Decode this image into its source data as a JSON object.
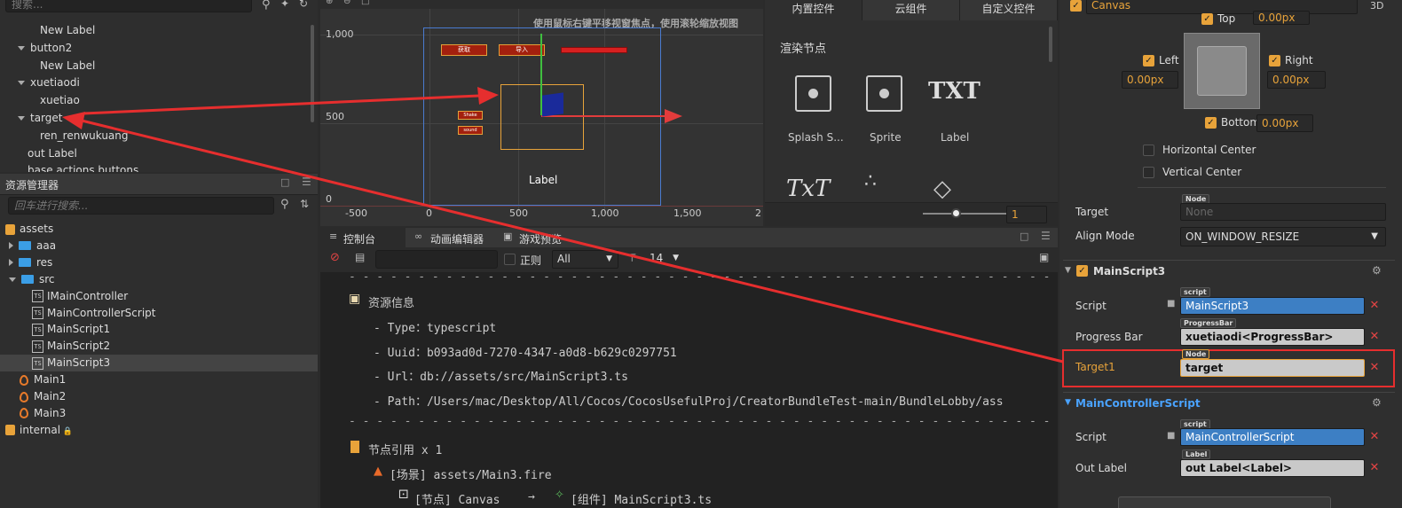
{
  "hierarchy": {
    "search_placeholder": "搜索...",
    "items": [
      {
        "label": "New Label",
        "level": 2,
        "arrow": "none"
      },
      {
        "label": "button2",
        "level": 1,
        "arrow": "down"
      },
      {
        "label": "New Label",
        "level": 2,
        "arrow": "none"
      },
      {
        "label": "xuetiaodi",
        "level": 1,
        "arrow": "down"
      },
      {
        "label": "xuetiao",
        "level": 2,
        "arrow": "none"
      },
      {
        "label": "target",
        "level": 1,
        "arrow": "down"
      },
      {
        "label": "ren_renwukuang",
        "level": 2,
        "arrow": "none"
      },
      {
        "label": "out Label",
        "level": 1,
        "arrow": "none"
      },
      {
        "label": "base actions buttons",
        "level": 1,
        "arrow": "none"
      }
    ]
  },
  "assets": {
    "title": "资源管理器",
    "search_placeholder": "回车进行搜索...",
    "items": [
      {
        "label": "assets",
        "type": "db"
      },
      {
        "label": "aaa",
        "type": "folder"
      },
      {
        "label": "res",
        "type": "folder"
      },
      {
        "label": "src",
        "type": "folder-open"
      },
      {
        "label": "IMainController",
        "type": "ts"
      },
      {
        "label": "MainControllerScript",
        "type": "ts"
      },
      {
        "label": "MainScript1",
        "type": "ts"
      },
      {
        "label": "MainScript2",
        "type": "ts"
      },
      {
        "label": "MainScript3",
        "type": "ts",
        "selected": true
      },
      {
        "label": "Main1",
        "type": "fire"
      },
      {
        "label": "Main2",
        "type": "fire"
      },
      {
        "label": "Main3",
        "type": "fire"
      },
      {
        "label": "internal",
        "type": "db-lock"
      }
    ]
  },
  "scene": {
    "hint": "使用鼠标右键平移视窗焦点，使用滚轮缩放视图",
    "y_ticks": [
      "1,000",
      "500",
      "0"
    ],
    "x_ticks": [
      "-500",
      "0",
      "500",
      "1,000",
      "1,500",
      "2"
    ],
    "label_text": "Label",
    "btn1": "获取",
    "btn2": "导入",
    "small1": "Shake",
    "small2": "sound"
  },
  "controls": {
    "tabs": [
      "内置控件",
      "云组件",
      "自定义控件"
    ],
    "section": "渲染节点",
    "items": [
      "Splash S...",
      "Sprite",
      "Label"
    ],
    "txt_icon": "TXT",
    "txt_italic": "TxT",
    "zoom_value": "1"
  },
  "console": {
    "tabs": [
      "控制台",
      "动画编辑器",
      "游戏预览"
    ],
    "regex_label": "正则",
    "filter_value": "All",
    "font_size": "14",
    "dashes": "- - - - - - - - - - - - - - - - - - - - - - - - - - - - - - - - - - - - - - - - - - - - - - - - - - - - - - - - - - -",
    "heading1": "资源信息",
    "lines": [
      "- Type：typescript",
      "- Uuid：b093ad0d-7270-4347-a0d8-b629c0297751",
      "- Url：db://assets/src/MainScript3.ts",
      "- Path：/Users/mac/Desktop/All/Cocos/CocosUsefulProj/CreatorBundleTest-main/BundleLobby/ass"
    ],
    "heading2": "节点引用 x 1",
    "scene_line": "[场景] assets/Main3.fire",
    "node_line_a": "[节点] Canvas",
    "node_line_arrow": "→",
    "node_line_b": "[组件] MainScript3.ts"
  },
  "inspector": {
    "canvas_name": "Canvas",
    "badge_3d": "3D",
    "widget": {
      "top_label": "Top",
      "top_value": "0.00px",
      "left_label": "Left",
      "left_value": "0.00px",
      "right_label": "Right",
      "right_value": "0.00px",
      "bottom_label": "Bottom",
      "bottom_value": "0.00px",
      "hcenter": "Horizontal Center",
      "vcenter": "Vertical Center",
      "target_label": "Target",
      "target_tag": "Node",
      "target_value": "None",
      "align_label": "Align Mode",
      "align_value": "ON_WINDOW_RESIZE"
    },
    "main_script3": {
      "title": "MainScript3",
      "script_label": "Script",
      "script_tag": "script",
      "script_value": "MainScript3",
      "progress_label": "Progress Bar",
      "progress_tag": "ProgressBar",
      "progress_value": "xuetiaodi<ProgressBar>",
      "target1_label": "Target1",
      "target1_tag": "Node",
      "target1_value": "target"
    },
    "main_controller": {
      "title": "MainControllerScript",
      "script_label": "Script",
      "script_tag": "script",
      "script_value": "MainControllerScript",
      "out_label": "Out Label",
      "out_tag": "Label",
      "out_value": "out Label<Label>"
    },
    "colors": {
      "accent": "#e8a33a",
      "highlight": "#e62e2e",
      "blue": "#3d7fc4",
      "link": "#4aa3ff"
    }
  }
}
